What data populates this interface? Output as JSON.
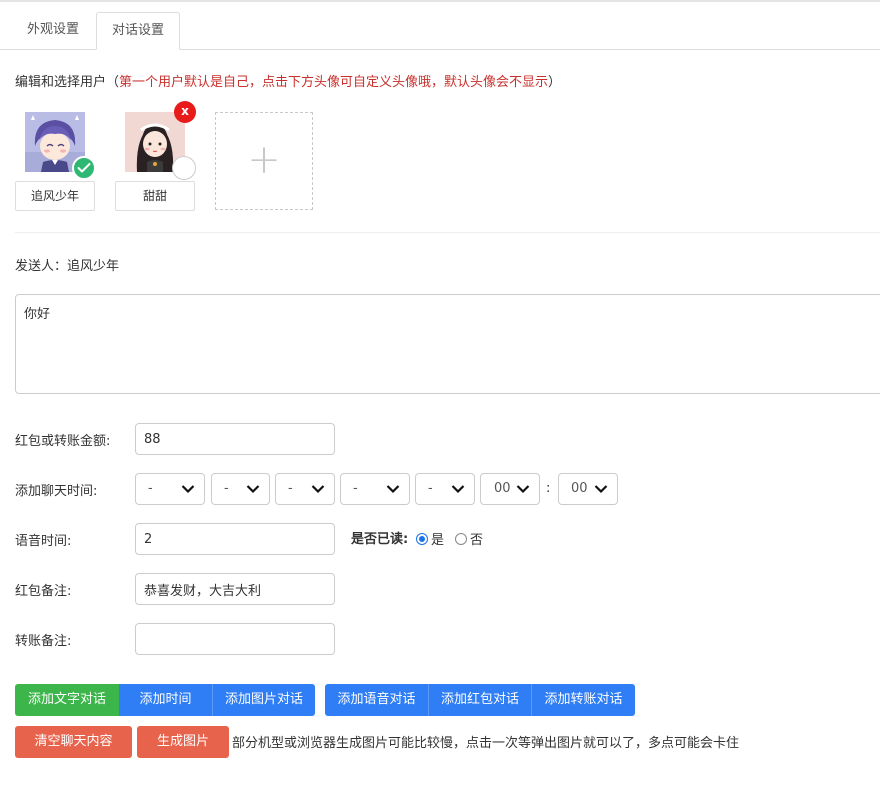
{
  "tabs": [
    {
      "label": "外观设置",
      "active": false
    },
    {
      "label": "对话设置",
      "active": true
    }
  ],
  "hint": {
    "prefix": "编辑和选择用户（",
    "red": "第一个用户默认是自己，点击下方头像可自定义头像哦，默认头像会不显示",
    "suffix": "）"
  },
  "users": [
    {
      "name": "追风少年",
      "selected": true,
      "deletable": false
    },
    {
      "name": "甜甜",
      "selected": false,
      "deletable": true
    }
  ],
  "delete_icon_text": "x",
  "add_user_symbol": "+",
  "sender": {
    "label": "发送人：",
    "name": "追风少年"
  },
  "message": {
    "value": "你好"
  },
  "amount": {
    "label": "红包或转账金额:",
    "value": "88"
  },
  "chat_time": {
    "label": "添加聊天时间:",
    "selects": [
      "-",
      "-",
      "-",
      "-",
      "-",
      "00",
      "00"
    ],
    "separator": ":"
  },
  "voice": {
    "label": "语音时间:",
    "value": "2"
  },
  "read": {
    "label": "是否已读:",
    "yes": "是",
    "no": "否",
    "selected": "是"
  },
  "red_packet_note": {
    "label": "红包备注:",
    "value": "恭喜发财，大吉大利"
  },
  "transfer_note": {
    "label": "转账备注:",
    "value": ""
  },
  "buttons": {
    "add_text": "添加文字对话",
    "add_time": "添加时间",
    "add_image": "添加图片对话",
    "add_voice": "添加语音对话",
    "add_red_packet": "添加红包对话",
    "add_transfer": "添加转账对话",
    "clear": "清空聊天内容",
    "generate": "生成图片"
  },
  "note": "部分机型或浏览器生成图片可能比较慢，点击一次等弹出图片就可以了，多点可能会卡住",
  "colors": {
    "green": "#3cb54a",
    "blue": "#2f7ef5",
    "orange": "#e8634c",
    "red": "#c9302c",
    "check": "#2eb872"
  }
}
